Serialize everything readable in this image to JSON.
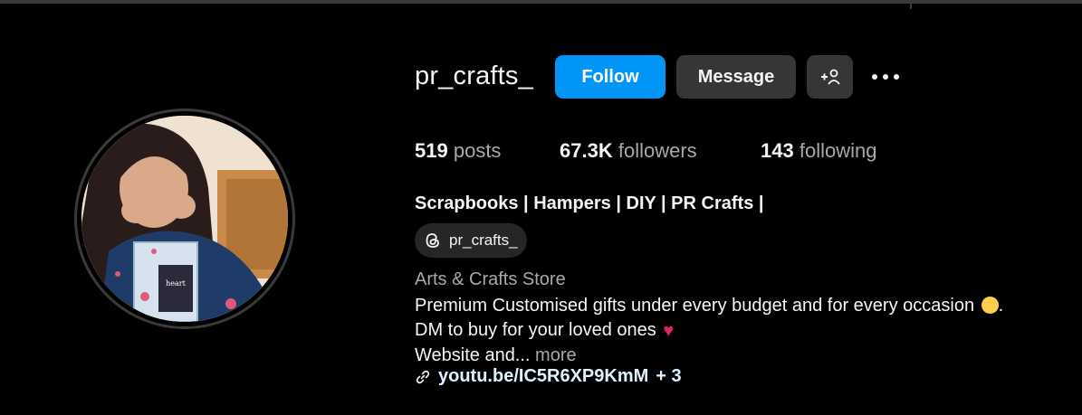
{
  "profile": {
    "username": "pr_crafts_",
    "full_name": "Scrapbooks | Hampers | DIY | PR Crafts |",
    "category": "Arts & Crafts Store",
    "bio_line1": "Premium Customised gifts under every budget and for every occasion",
    "bio_line1_end": ".",
    "bio_line2": "DM to buy for your loved ones",
    "bio_line3": "Website and...",
    "more_label": "more",
    "link_text": "youtu.be/IC5R6XP9KmM",
    "link_extra": "+ 3",
    "threads_handle": "pr_crafts_"
  },
  "actions": {
    "follow_label": "Follow",
    "message_label": "Message",
    "add_user_icon": "person-add-icon",
    "more_icon": "more-horizontal-icon"
  },
  "stats": {
    "posts_count": "519",
    "posts_label": "posts",
    "followers_count": "67.3K",
    "followers_label": "followers",
    "following_count": "143",
    "following_label": "following"
  },
  "colors": {
    "background": "#000000",
    "follow_button": "#0095f6",
    "secondary_button": "#363636",
    "muted_text": "#a8a8a8"
  }
}
